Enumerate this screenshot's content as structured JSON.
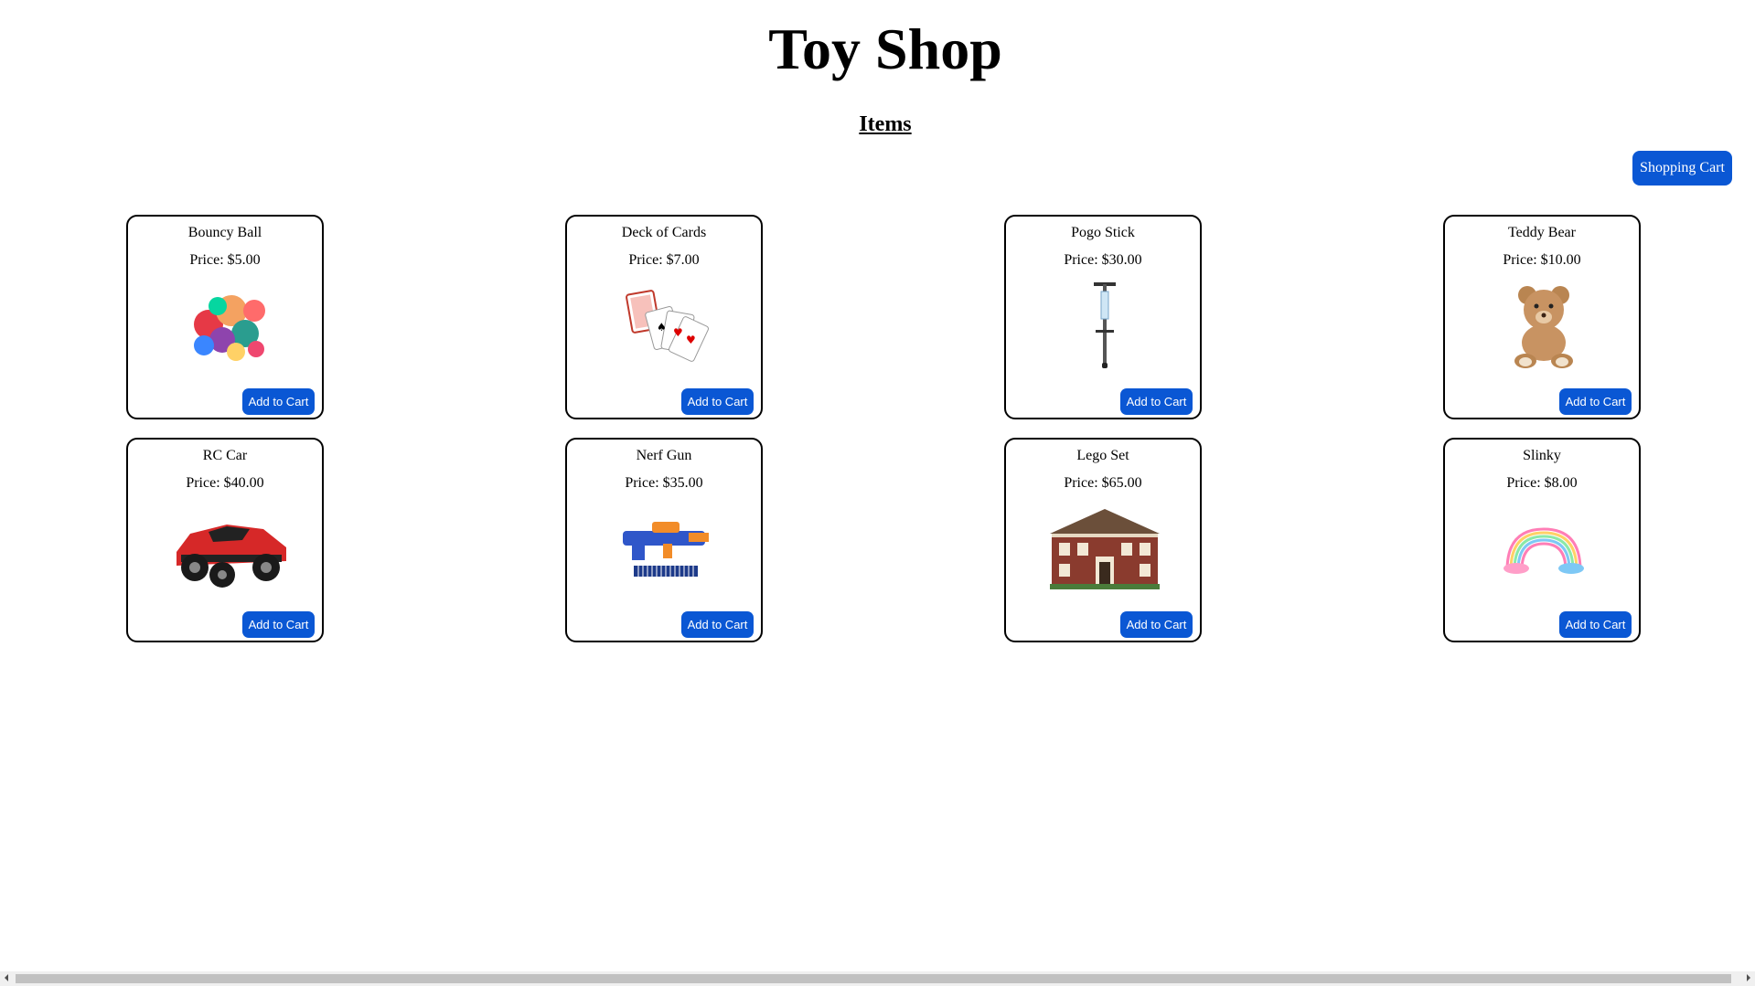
{
  "header": {
    "title": "Toy Shop",
    "section_heading": "Items"
  },
  "cart_button_label": "Shopping Cart",
  "price_prefix": "Price: ",
  "add_to_cart_label": "Add to Cart",
  "accent_color": "#0a57d4",
  "items": [
    {
      "name": "Bouncy Ball",
      "price": "$5.00",
      "icon": "bouncy-balls-image"
    },
    {
      "name": "Deck of Cards",
      "price": "$7.00",
      "icon": "playing-cards-image"
    },
    {
      "name": "Pogo Stick",
      "price": "$30.00",
      "icon": "pogo-stick-image"
    },
    {
      "name": "Teddy Bear",
      "price": "$10.00",
      "icon": "teddy-bear-image"
    },
    {
      "name": "RC Car",
      "price": "$40.00",
      "icon": "rc-car-image"
    },
    {
      "name": "Nerf Gun",
      "price": "$35.00",
      "icon": "nerf-gun-image"
    },
    {
      "name": "Lego Set",
      "price": "$65.00",
      "icon": "lego-set-image"
    },
    {
      "name": "Slinky",
      "price": "$8.00",
      "icon": "slinky-image"
    }
  ]
}
